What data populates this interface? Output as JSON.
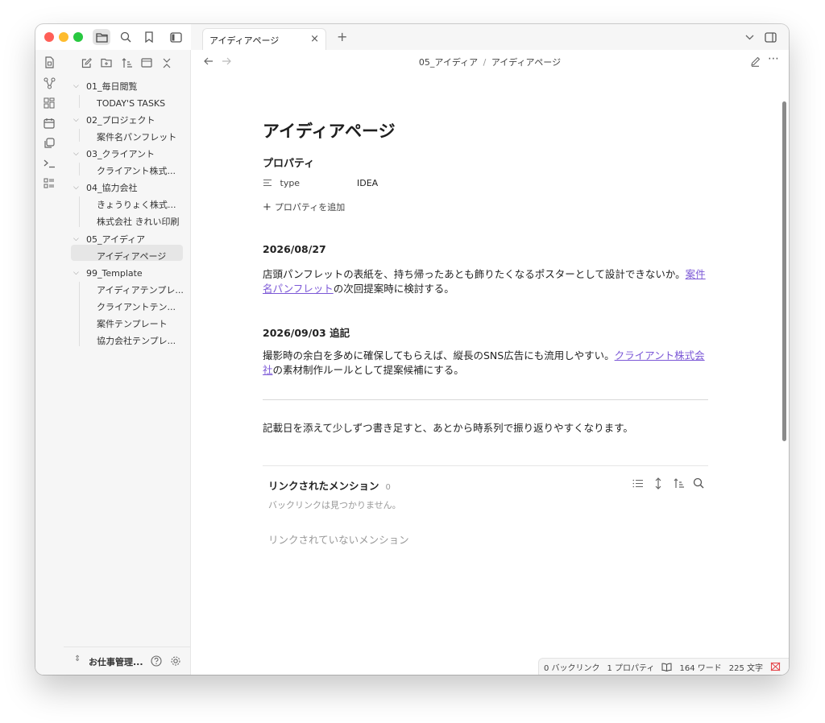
{
  "window": {
    "traffic_colors": [
      "#ff5f57",
      "#febc2e",
      "#28c840"
    ]
  },
  "tab": {
    "label": "アイディアページ",
    "close": "×",
    "new": "+"
  },
  "breadcrumb": {
    "folder": "05_アイディア",
    "separator": "/",
    "page": "アイディアページ"
  },
  "sidebar": {
    "tree": [
      {
        "type": "folder",
        "label": "01_毎日閲覧"
      },
      {
        "type": "file",
        "label": "TODAY'S TASKS"
      },
      {
        "type": "folder",
        "label": "02_プロジェクト"
      },
      {
        "type": "file",
        "label": "案件名パンフレット"
      },
      {
        "type": "folder",
        "label": "03_クライアント"
      },
      {
        "type": "file",
        "label": "クライアント株式..."
      },
      {
        "type": "folder",
        "label": "04_協力会社"
      },
      {
        "type": "file",
        "label": "きょうりょく株式..."
      },
      {
        "type": "file",
        "label": "株式会社 きれい印刷"
      },
      {
        "type": "folder",
        "label": "05_アイディア"
      },
      {
        "type": "file",
        "label": "アイディアページ",
        "active": true
      },
      {
        "type": "folder",
        "label": "99_Template"
      },
      {
        "type": "file",
        "label": "アイディアテンプレ..."
      },
      {
        "type": "file",
        "label": "クライアントテン..."
      },
      {
        "type": "file",
        "label": "案件テンプレート"
      },
      {
        "type": "file",
        "label": "協力会社テンプレ..."
      }
    ],
    "vault_name": "お仕事管理..."
  },
  "note": {
    "title": "アイディアページ",
    "properties_heading": "プロパティ",
    "property": {
      "key": "type",
      "value": "IDEA"
    },
    "add_property": "プロパティを追加",
    "section1": {
      "date": "2026/08/27",
      "text_before": "店頭パンフレットの表紙を、持ち帰ったあとも飾りたくなるポスターとして設計できないか。",
      "link": "案件名パンフレット",
      "text_after": "の次回提案時に検討する。"
    },
    "section2": {
      "date": "2026/09/03 追記",
      "text_before": "撮影時の余白を多めに確保してもらえば、縦長のSNS広告にも流用しやすい。",
      "link": "クライアント株式会社",
      "text_after": "の素材制作ルールとして提案候補にする。"
    },
    "footer_text": "記載日を添えて少しずつ書き足すと、あとから時系列で振り返りやすくなります。"
  },
  "backlinks": {
    "title": "リンクされたメンション",
    "count": "0",
    "empty": "バックリンクは見つかりません。",
    "unlinked": "リンクされていないメンション"
  },
  "status_bar": {
    "backlinks": "0 バックリンク",
    "properties": "1 プロパティ",
    "words": "164 ワード",
    "chars": "225 文字"
  },
  "colors": {
    "link": "#7b57d6",
    "sync_error": "#e5484d"
  }
}
